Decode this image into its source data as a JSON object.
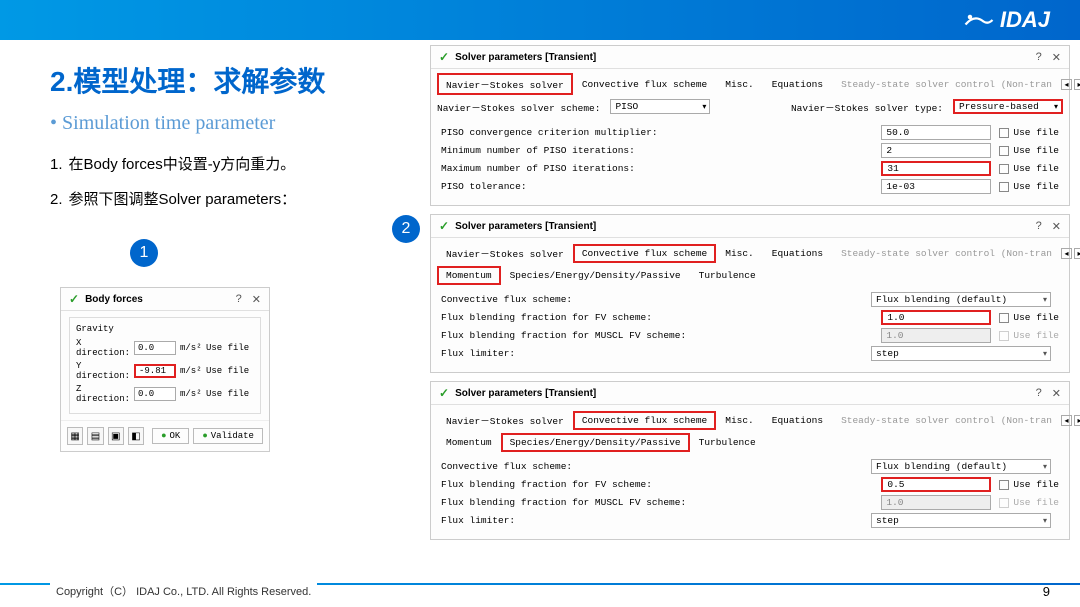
{
  "header": {
    "logo_text": "IDAJ"
  },
  "title": "2.模型处理：求解参数",
  "subtitle": "Simulation time parameter",
  "steps": [
    {
      "num": "1.",
      "text": "在Body forces中设置-y方向重力。"
    },
    {
      "num": "2.",
      "text": "参照下图调整Solver parameters："
    }
  ],
  "markers": {
    "one": "1",
    "two": "2"
  },
  "body_forces": {
    "title": "Body forces",
    "help": "?",
    "close": "✕",
    "gravity": "Gravity",
    "rows": [
      {
        "dir": "X direction:",
        "val": "0.0",
        "unit": "m/s²",
        "cb": "Use file",
        "hl": false
      },
      {
        "dir": "Y direction:",
        "val": "-9.81",
        "unit": "m/s²",
        "cb": "Use file",
        "hl": true
      },
      {
        "dir": "Z direction:",
        "val": "0.0",
        "unit": "m/s²",
        "cb": "Use file",
        "hl": false
      }
    ],
    "ok": "OK",
    "validate": "Validate"
  },
  "solver_panels": {
    "title": "Solver parameters [Transient]",
    "help": "?",
    "close": "✕",
    "tabs": {
      "ns": "Navier－Stokes solver",
      "conv": "Convective flux scheme",
      "misc": "Misc.",
      "eq": "Equations",
      "steady": "Steady-state solver control (Non-tran"
    },
    "subtabs": {
      "mom": "Momentum",
      "sep": "Species/Energy/Density/Passive",
      "turb": "Turbulence"
    },
    "p1": {
      "scheme_lbl": "Navier－Stokes solver scheme:",
      "scheme_val": "PISO",
      "type_lbl": "Navier－Stokes solver type:",
      "type_val": "Pressure-based",
      "r1_lbl": "PISO convergence criterion multiplier:",
      "r1_val": "50.0",
      "r2_lbl": "Minimum number of PISO iterations:",
      "r2_val": "2",
      "r3_lbl": "Maximum number of PISO iterations:",
      "r3_val": "31",
      "r4_lbl": "PISO tolerance:",
      "r4_val": "1e-03",
      "cb": "Use file"
    },
    "p2": {
      "r1_lbl": "Convective flux scheme:",
      "r1_val": "Flux blending (default)",
      "r2_lbl": "Flux blending fraction for FV scheme:",
      "r2_val": "1.0",
      "r3_lbl": "Flux blending fraction for MUSCL FV scheme:",
      "r3_val": "1.0",
      "r4_lbl": "Flux limiter:",
      "r4_val": "step",
      "cb": "Use file"
    },
    "p3": {
      "r1_lbl": "Convective flux scheme:",
      "r1_val": "Flux blending (default)",
      "r2_lbl": "Flux blending fraction for FV scheme:",
      "r2_val": "0.5",
      "r3_lbl": "Flux blending fraction for MUSCL FV scheme:",
      "r3_val": "1.0",
      "r4_lbl": "Flux limiter:",
      "r4_val": "step",
      "cb": "Use file"
    }
  },
  "footer": {
    "copyright": "Copyright（C） IDAJ Co., LTD. All Rights Reserved.",
    "page": "9"
  }
}
